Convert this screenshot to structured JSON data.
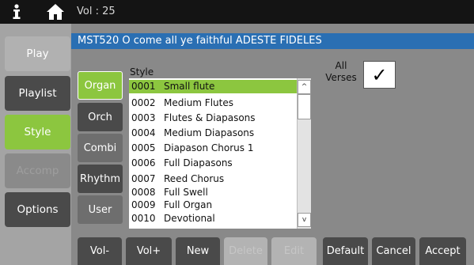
{
  "topbar": {
    "volume_text": "Vol : 25",
    "info_icon": "info-icon",
    "home_icon": "home-icon"
  },
  "sidebar": {
    "items": [
      {
        "label": "Play"
      },
      {
        "label": "Playlist"
      },
      {
        "label": "Style"
      },
      {
        "label": "Accomp"
      },
      {
        "label": "Options"
      }
    ]
  },
  "title": "MST520  O come all ye faithful  ADESTE FIDELES",
  "voices": [
    {
      "label": "Organ"
    },
    {
      "label": "Orch"
    },
    {
      "label": "Combi"
    },
    {
      "label": "Rhythm"
    },
    {
      "label": "User"
    }
  ],
  "style_list": {
    "label": "Style",
    "selected_index": 0,
    "items": [
      {
        "num": "0001",
        "name": "Small flute"
      },
      {
        "num": "0002",
        "name": "Medium Flutes"
      },
      {
        "num": "0003",
        "name": "Flutes & Diapasons"
      },
      {
        "num": "0004",
        "name": "Medium Diapasons"
      },
      {
        "num": "0005",
        "name": "Diapason Chorus 1"
      },
      {
        "num": "0006",
        "name": "Full Diapasons"
      },
      {
        "num": "0007",
        "name": "Reed Chorus"
      },
      {
        "num": "0008",
        "name": "Full Swell"
      },
      {
        "num": "0009",
        "name": "Full Organ"
      },
      {
        "num": "0010",
        "name": "Devotional"
      }
    ],
    "scroll_up": "^",
    "scroll_down": "v"
  },
  "all_verses": {
    "line1": "All",
    "line2": "Verses",
    "checked": true,
    "check_mark": "✓"
  },
  "bottom": {
    "buttons": [
      {
        "label": "Vol-"
      },
      {
        "label": "Vol+"
      },
      {
        "label": "New"
      },
      {
        "label": "Delete"
      },
      {
        "label": "Edit"
      },
      {
        "label": "Default"
      },
      {
        "label": "Cancel"
      },
      {
        "label": "Accept"
      }
    ]
  },
  "colors": {
    "accent": "#8cc63f",
    "title_bar": "#2a6fb3",
    "dark_button": "#4a4a4a"
  }
}
